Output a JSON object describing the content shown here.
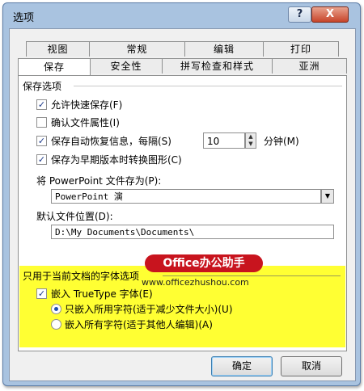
{
  "window": {
    "title": "选项",
    "help_label": "?",
    "close_label": "X"
  },
  "tabs_row1": [
    "视图",
    "常规",
    "编辑",
    "打印"
  ],
  "tabs_row2": [
    "保存",
    "安全性",
    "拼写检查和样式",
    "亚洲"
  ],
  "active_tab": "保存",
  "save_options": {
    "title": "保存选项",
    "allow_fast_save": {
      "label": "允许快速保存(F)",
      "checked": true
    },
    "prompt_file_props": {
      "label": "确认文件属性(I)",
      "checked": false
    },
    "autorecover": {
      "label": "保存自动恢复信息，每隔(S)",
      "checked": true,
      "value": "10",
      "unit": "分钟(M)"
    },
    "convert_graphics": {
      "label": "保存为早期版本时转换图形(C)",
      "checked": true
    }
  },
  "save_as": {
    "label": "将 PowerPoint 文件存为(P):",
    "value": "PowerPoint 演"
  },
  "default_location": {
    "label": "默认文件位置(D):",
    "value": "D:\\My Documents\\Documents\\"
  },
  "font_options": {
    "title": "只用于当前文档的字体选项",
    "embed_truetype": {
      "label": "嵌入 TrueType 字体(E)",
      "checked": true
    },
    "embed_used_only": {
      "label": "只嵌入所用字符(适于减少文件大小)(U)",
      "selected": true
    },
    "embed_all": {
      "label": "嵌入所有字符(适于其他人编辑)(A)",
      "selected": false
    }
  },
  "watermark": {
    "badge": "Office办公助手",
    "url": "www.officezhushou.com"
  },
  "buttons": {
    "ok": "确定",
    "cancel": "取消"
  },
  "colors": {
    "highlight": "#ffff33",
    "badge": "#c8141e",
    "title_bar": "#a9c3e0"
  }
}
